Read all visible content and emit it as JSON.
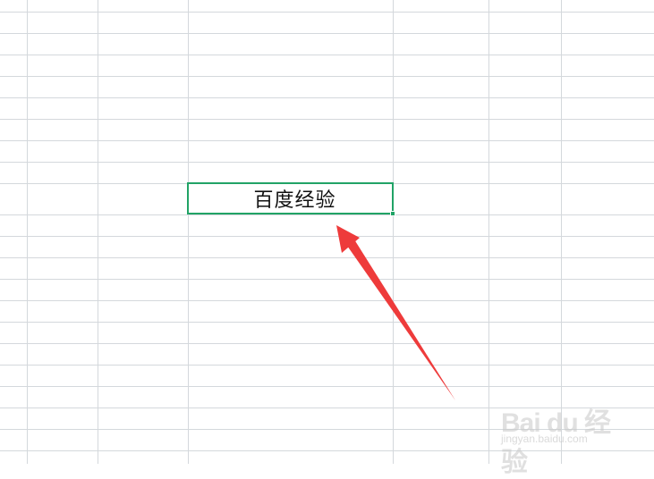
{
  "sheet": {
    "active_cell_text": "百度经验",
    "accent_color": "#21a366",
    "grid_color": "#d4d8dc",
    "annotation_arrow_color": "#ee3b3b"
  },
  "watermark": {
    "logo_text": "Bai du 经验",
    "sub_text": "jingyan.baidu.com"
  }
}
